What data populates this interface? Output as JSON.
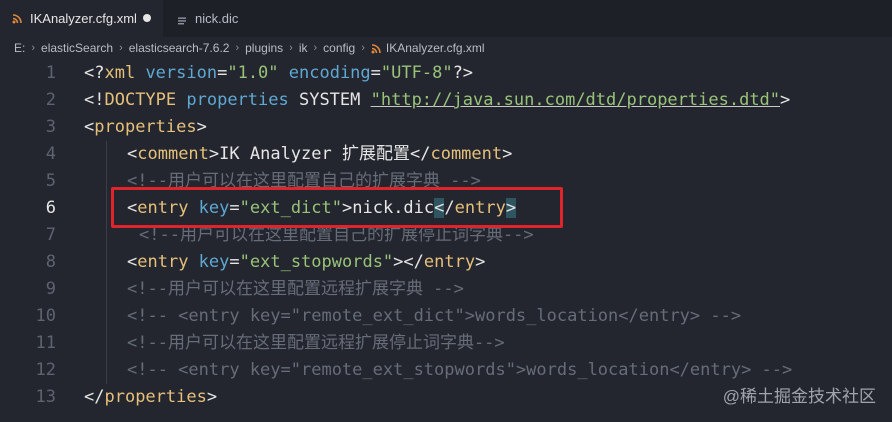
{
  "tabs": [
    {
      "label": "IKAnalyzer.cfg.xml",
      "active": true,
      "modified": true,
      "icon": "rss-icon"
    },
    {
      "label": "nick.dic",
      "active": false,
      "icon": "file-icon"
    }
  ],
  "breadcrumb": [
    "E:",
    "elasticSearch",
    "elasticsearch-7.6.2",
    "plugins",
    "ik",
    "config",
    "IKAnalyzer.cfg.xml"
  ],
  "active_line": 6,
  "line_numbers": [
    "1",
    "2",
    "3",
    "4",
    "5",
    "6",
    "7",
    "8",
    "9",
    "10",
    "11",
    "12",
    "13"
  ],
  "code": {
    "l1": {
      "a": "<?",
      "b": "xml",
      "c": " version",
      "d": "=",
      "e": "\"1.0\"",
      "f": " encoding",
      "g": "=",
      "h": "\"UTF-8\"",
      "i": "?>"
    },
    "l2": {
      "a": "<!",
      "b": "DOCTYPE",
      "c": " properties ",
      "d": "SYSTEM ",
      "e": "\"http://java.sun.com/dtd/properties.dtd\"",
      "f": ">"
    },
    "l3": {
      "a": "<",
      "b": "properties",
      "c": ">"
    },
    "l4": {
      "a": "<",
      "b": "comment",
      "c": ">",
      "d": "IK Analyzer 扩展配置",
      "e": "</",
      "f": "comment",
      "g": ">"
    },
    "l5": {
      "a": "<!--用户可以在这里配置自己的扩展字典 -->"
    },
    "l6": {
      "a": "<",
      "b": "entry",
      "c": " key",
      "d": "=",
      "e": "\"ext_dict\"",
      "f": ">",
      "g": "nick.dic",
      "h": "<",
      "i": "/",
      "j": "entry",
      ">": ">"
    },
    "l7": {
      "a": "<!--用户可以在这里配置自己的扩展停止词字典-->"
    },
    "l8": {
      "a": "<",
      "b": "entry",
      "c": " key",
      "d": "=",
      "e": "\"ext_stopwords\"",
      "f": ">",
      "g": "</",
      "h": "entry",
      "i": ">"
    },
    "l9": {
      "a": "<!--用户可以在这里配置远程扩展字典 -->"
    },
    "l10": {
      "a": "<!-- <entry key=\"remote_ext_dict\">words_location</entry> -->"
    },
    "l11": {
      "a": "<!--用户可以在这里配置远程扩展停止词字典-->"
    },
    "l12": {
      "a": "<!-- <entry key=\"remote_ext_stopwords\">words_location</entry> -->"
    },
    "l13": {
      "a": "</",
      "b": "properties",
      "c": ">"
    }
  },
  "watermark": "@稀土掘金技术社区",
  "colors": {
    "background": "#23262e",
    "tag": "#e6c07b",
    "attribute": "#5fa8d3",
    "string": "#98c379",
    "comment": "#666c78",
    "highlight_box": "#e0242c"
  }
}
